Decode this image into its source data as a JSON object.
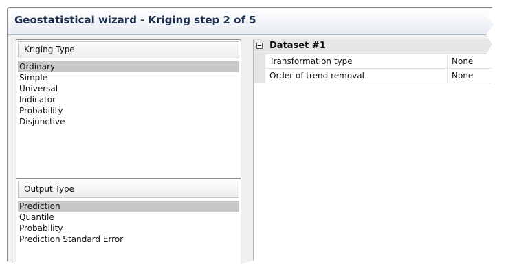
{
  "window": {
    "title": "Geostatistical wizard - Kriging step 2 of 5"
  },
  "kriging_type": {
    "header": "Kriging Type",
    "selected": "Ordinary",
    "items": [
      "Ordinary",
      "Simple",
      "Universal",
      "Indicator",
      "Probability",
      "Disjunctive"
    ]
  },
  "output_type": {
    "header": "Output Type",
    "selected": "Prediction",
    "items": [
      "Prediction",
      "Quantile",
      "Probability",
      "Prediction Standard Error"
    ]
  },
  "property_grid": {
    "category": "Dataset #1",
    "expand_icon": "minus-box",
    "rows": [
      {
        "name": "Transformation type",
        "value": "None"
      },
      {
        "name": "Order of trend removal",
        "value": "None"
      }
    ]
  },
  "colors": {
    "selection": "#c8c8c8",
    "title_text": "#1e3050"
  }
}
